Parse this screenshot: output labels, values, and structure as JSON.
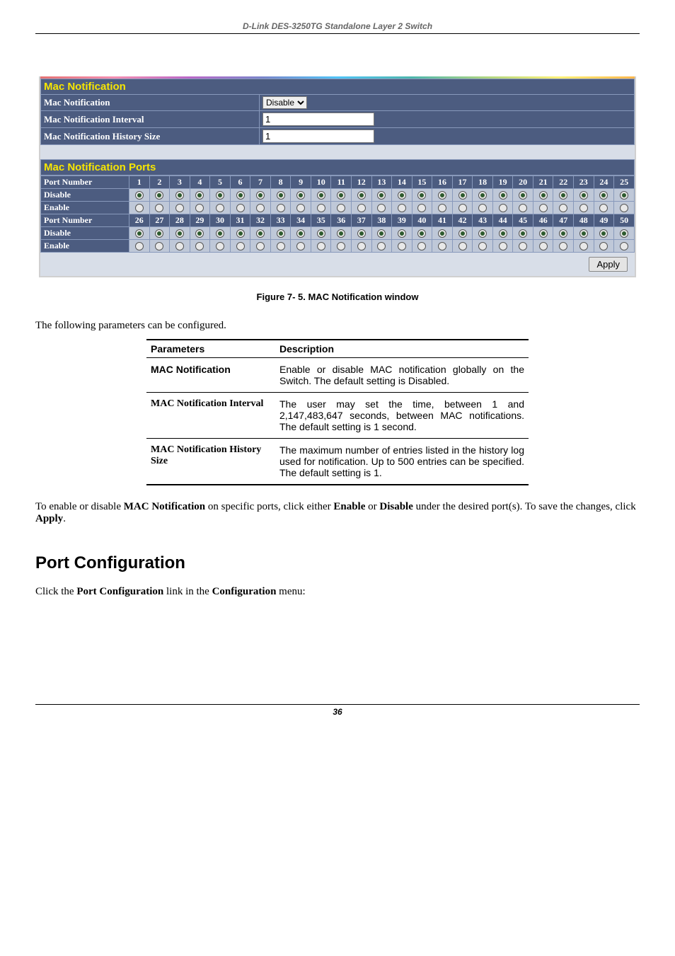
{
  "top_title": "D-Link DES-3250TG Standalone Layer 2 Switch",
  "panel": {
    "mac_notif_title": "Mac Notification",
    "ports_title": "Mac Notification Ports",
    "rows": {
      "mac_notif_label": "Mac Notification",
      "interval_label": "Mac Notification Interval",
      "history_label": "Mac Notification History Size",
      "port_number_label": "Port Number",
      "disable_label": "Disable",
      "enable_label": "Enable"
    },
    "mac_notif_select_value": "Disable",
    "interval_value": "1",
    "history_value": "1",
    "ports_row1": [
      "1",
      "2",
      "3",
      "4",
      "5",
      "6",
      "7",
      "8",
      "9",
      "10",
      "11",
      "12",
      "13",
      "14",
      "15",
      "16",
      "17",
      "18",
      "19",
      "20",
      "21",
      "22",
      "23",
      "24",
      "25"
    ],
    "ports_row2": [
      "26",
      "27",
      "28",
      "29",
      "30",
      "31",
      "32",
      "33",
      "34",
      "35",
      "36",
      "37",
      "38",
      "39",
      "40",
      "41",
      "42",
      "43",
      "44",
      "45",
      "46",
      "47",
      "48",
      "49",
      "50"
    ],
    "apply_label": "Apply"
  },
  "figure_caption": "Figure 7- 5. MAC Notification window",
  "intro_line": "The following parameters can be configured.",
  "param_table": {
    "head_param": "Parameters",
    "head_desc": "Description",
    "r1_name": "MAC Notification",
    "r1_desc": "Enable or disable MAC notification globally on the Switch. The default setting is Disabled.",
    "r2_name": "MAC Notification Interval",
    "r2_desc": "The user may set the time, between 1 and 2,147,483,647 seconds, between MAC notifications. The default setting is 1 second.",
    "r3_name": "MAC Notification History Size",
    "r3_desc": "The maximum number of entries listed in the history log used for notification. Up to 500 entries can be specified. The default setting is 1."
  },
  "after_table_html": "To enable or disable <b>MAC Notification</b> on specific ports, click either <b>Enable</b> or <b>Disable</b> under the desired port(s).  To save the changes, click <b>Apply</b>.",
  "section_head": "Port Configuration",
  "section_body_html": "Click the <b>Port Configuration</b> link in the <b>Configuration</b> menu:",
  "page_number": "36"
}
